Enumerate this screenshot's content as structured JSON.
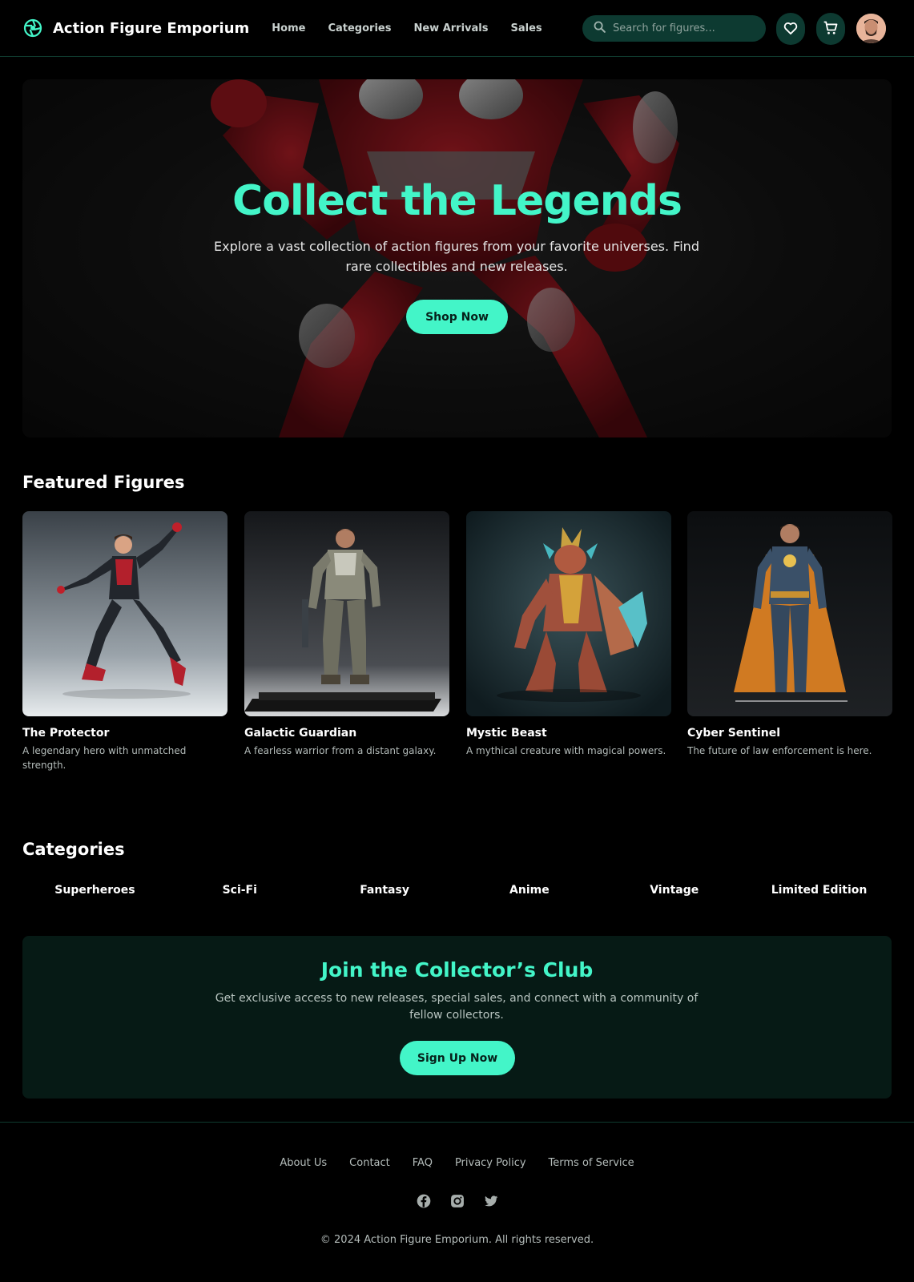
{
  "header": {
    "brand": "Action Figure Emporium",
    "nav": [
      "Home",
      "Categories",
      "New Arrivals",
      "Sales"
    ],
    "search_placeholder": "Search for figures..."
  },
  "hero": {
    "title": "Collect the Legends",
    "subtitle": "Explore a vast collection of action figures from your favorite universes. Find rare collectibles and new releases.",
    "button": "Shop Now"
  },
  "featured": {
    "title": "Featured Figures",
    "items": [
      {
        "name": "The Protector",
        "description": "A legendary hero with unmatched strength."
      },
      {
        "name": "Galactic Guardian",
        "description": "A fearless warrior from a distant galaxy."
      },
      {
        "name": "Mystic Beast",
        "description": "A mythical creature with magical powers."
      },
      {
        "name": "Cyber Sentinel",
        "description": "The future of law enforcement is here."
      }
    ]
  },
  "categories": {
    "title": "Categories",
    "items": [
      "Superheroes",
      "Sci-Fi",
      "Fantasy",
      "Anime",
      "Vintage",
      "Limited Edition"
    ]
  },
  "club": {
    "title": "Join the Collector’s Club",
    "subtitle": "Get exclusive access to new releases, special sales, and connect with a community of fellow collectors.",
    "button": "Sign Up Now"
  },
  "footer": {
    "links": [
      "About Us",
      "Contact",
      "FAQ",
      "Privacy Policy",
      "Terms of Service"
    ],
    "copyright": "© 2024 Action Figure Emporium. All rights reserved."
  },
  "icons": {
    "logo": "aperture-icon",
    "search": "search-icon",
    "wishlist": "heart-icon",
    "cart": "cart-icon",
    "socials": [
      "facebook-icon",
      "instagram-icon",
      "twitter-icon"
    ]
  },
  "colors": {
    "accent": "#43f5c8",
    "background": "#000000",
    "panel": "#061a15",
    "chip": "#0d3a31"
  }
}
